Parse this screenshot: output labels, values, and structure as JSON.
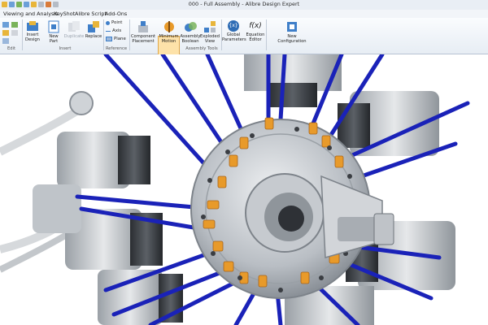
{
  "window": {
    "title": "000 - Full Assembly - Alibre Design Expert"
  },
  "menu": {
    "items": [
      "Viewing and Analysis",
      "KeyShot",
      "Alibre Script",
      "Add-Ons"
    ]
  },
  "ribbon": {
    "groups": {
      "edit": "Edit",
      "insert": "Insert",
      "reference": "Reference",
      "assembly_tools": "Assembly Tools"
    },
    "buttons": {
      "insert_design": [
        "Insert",
        "Design"
      ],
      "new_part": [
        "New",
        "Part"
      ],
      "duplicate": "Duplicate",
      "replace": "Replace",
      "point": "Point",
      "axis": "Axis",
      "plane": "Plane",
      "component_placement": [
        "Component",
        "Placement"
      ],
      "minimum_motion": [
        "Minimum",
        "Motion"
      ],
      "assembly_boolean": [
        "Assembly",
        "Boolean"
      ],
      "exploded_view": [
        "Exploded",
        "View"
      ],
      "global_parameters": [
        "Global",
        "Parameters"
      ],
      "equation_editor": [
        "Equation",
        "Editor"
      ],
      "new_configuration": [
        "New",
        "Configuration"
      ]
    },
    "icon_glyphs": {
      "global_parameters": "{x}",
      "equation_editor": "f(x)"
    },
    "colors": {
      "highlight": "#fde2a9",
      "accent": "#2f6db5"
    }
  },
  "viewport": {
    "model": "radial-engine-assembly",
    "colors": {
      "pushrod": "#1a22b8",
      "spring": "#e89a2a",
      "metal": "#c9ccd0",
      "background": "#ffffff"
    }
  }
}
